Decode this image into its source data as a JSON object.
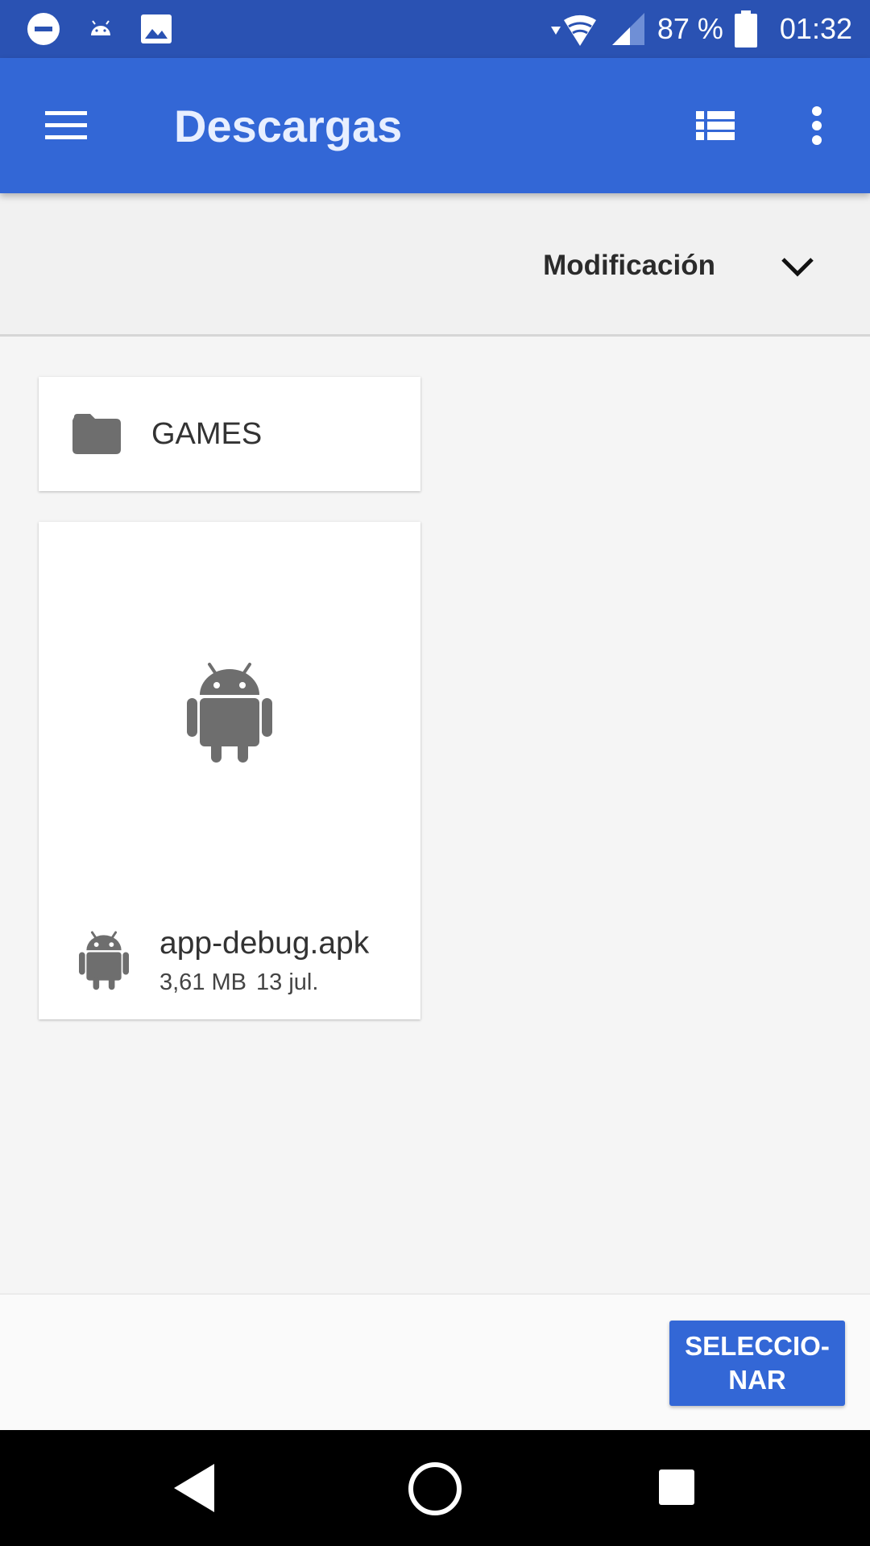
{
  "status_bar": {
    "battery": "87 %",
    "time": "01:32",
    "icons": [
      "do-not-disturb-icon",
      "android-notification-icon",
      "image-notification-icon",
      "wifi-icon",
      "signal-icon",
      "battery-icon"
    ]
  },
  "app_bar": {
    "title": "Descargas",
    "icons": [
      "menu-icon",
      "list-view-icon",
      "more-vert-icon"
    ]
  },
  "sort": {
    "label": "Modificación",
    "icon": "chevron-down-icon"
  },
  "items": [
    {
      "type": "folder",
      "name": "GAMES",
      "icon": "folder-icon"
    },
    {
      "type": "file",
      "name": "app-debug.apk",
      "size": "3,61 MB",
      "date": "13 jul.",
      "icon": "android-icon"
    }
  ],
  "bottom_bar": {
    "select_label": "SELECCIO-NAR"
  },
  "nav_bar": {
    "icons": [
      "back-icon",
      "home-icon",
      "recents-icon"
    ]
  },
  "colors": {
    "status_bar": "#2a52b3",
    "app_bar": "#3367d6",
    "accent": "#3367d6",
    "icon_gray": "#6e6e6e"
  }
}
